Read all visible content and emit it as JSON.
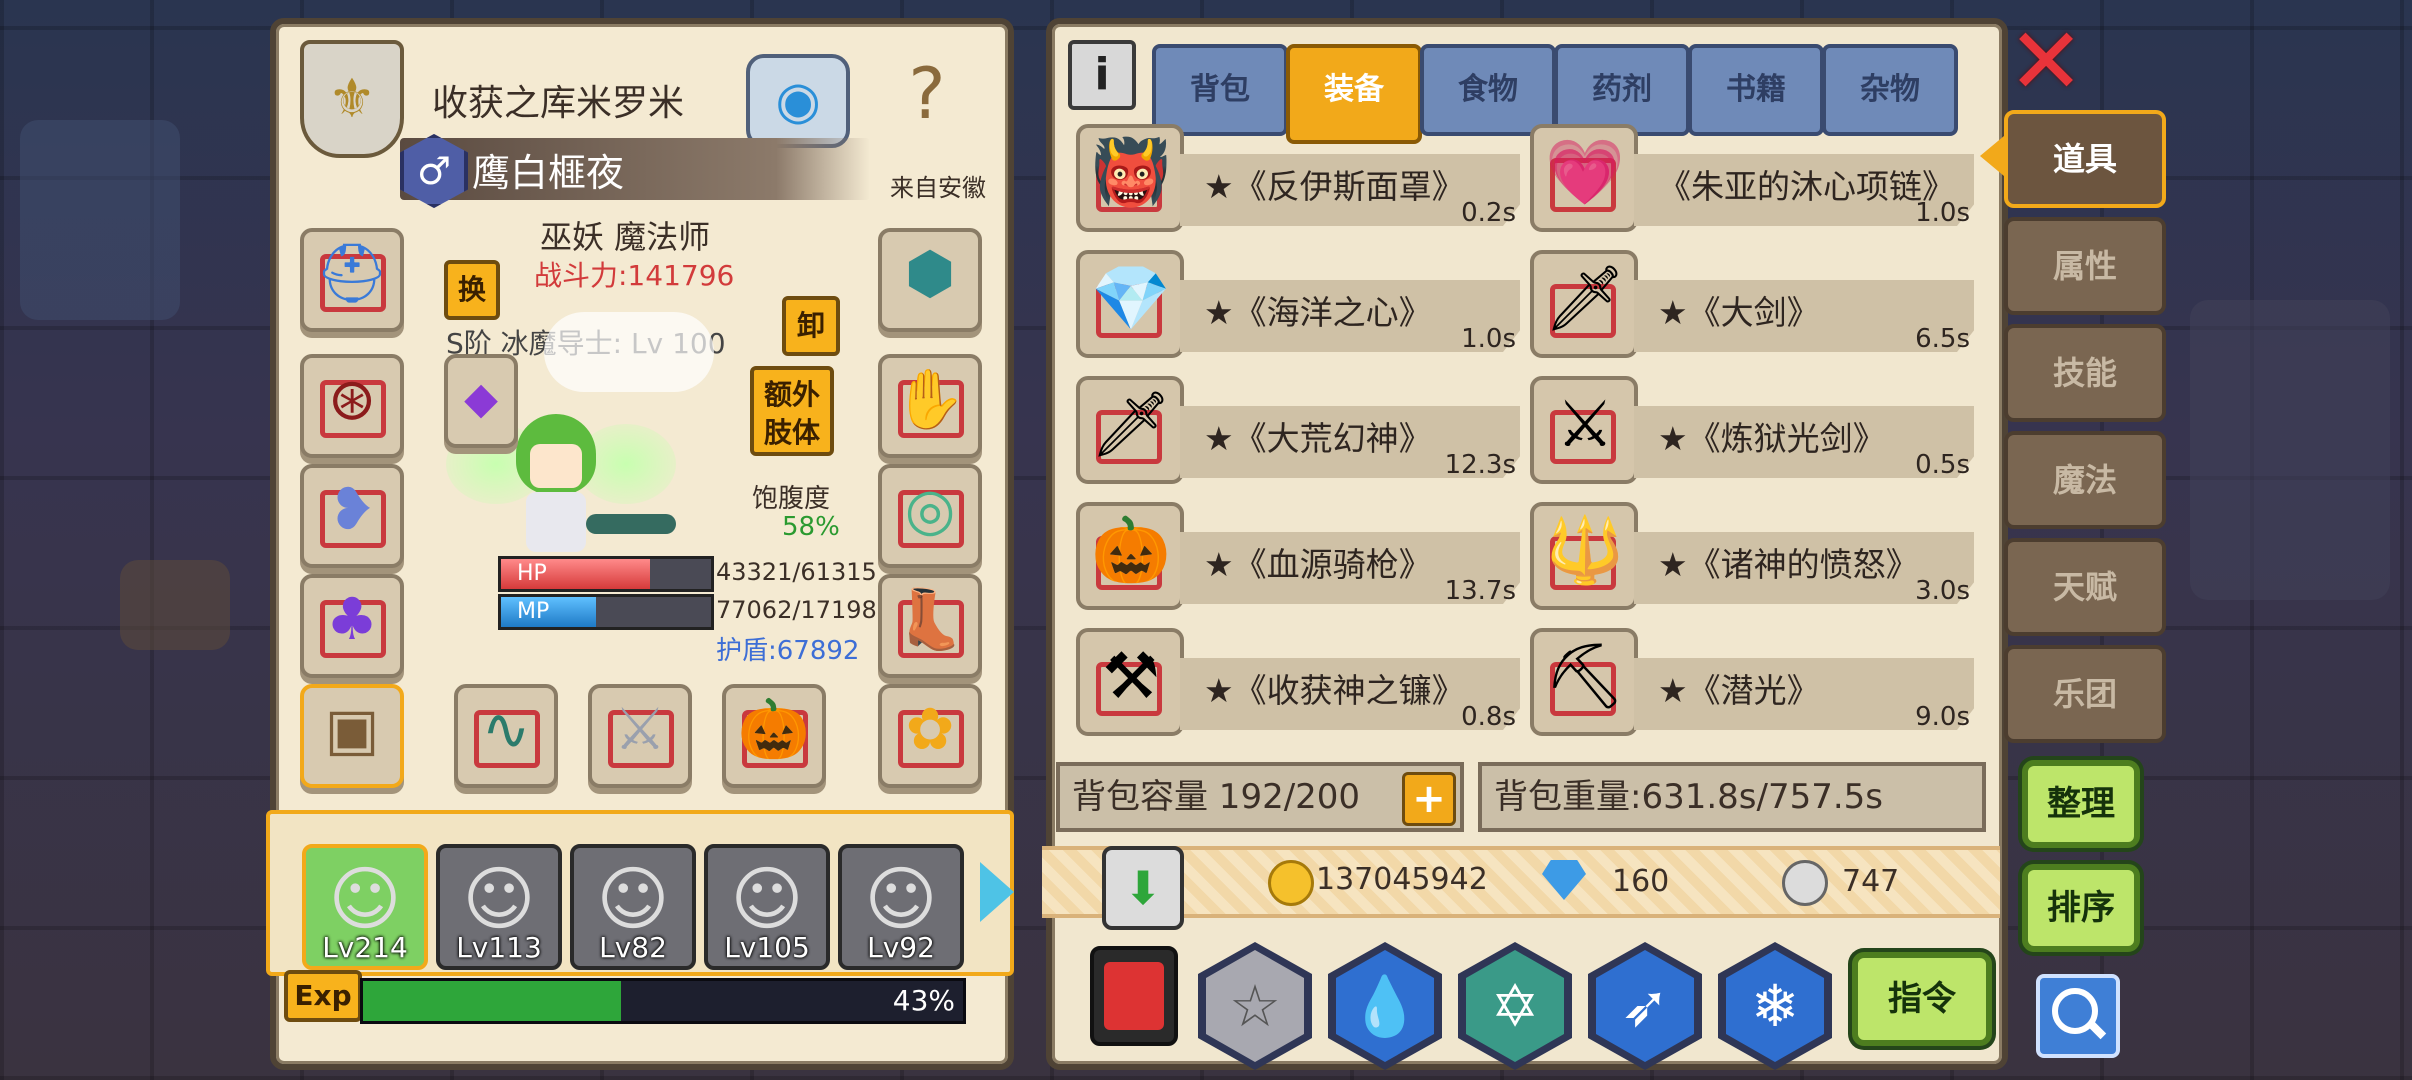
{
  "character": {
    "title": "收获之库米罗米",
    "name": "鹰白榧夜",
    "gender_symbol": "♂",
    "origin": "来自安徽",
    "race_class": "巫妖 魔法师",
    "power": "战斗力:141796",
    "swap_label": "换",
    "unequip_label": "卸",
    "extra_limb_label": "额外\n肢体",
    "rank_line": "S阶 冰魔导士: Lv 100",
    "satiety_label": "饱腹度",
    "satiety_value": "58%",
    "hp_label": "HP",
    "mp_label": "MP",
    "hp_value": "43321/61315",
    "mp_value": "77062/17198",
    "hp_fraction": 0.71,
    "mp_fraction": 0.45,
    "shield": "护盾:67892"
  },
  "party": [
    {
      "level": "Lv214",
      "active": true
    },
    {
      "level": "Lv113",
      "active": false
    },
    {
      "level": "Lv82",
      "active": false
    },
    {
      "level": "Lv105",
      "active": false
    },
    {
      "level": "Lv92",
      "active": false
    }
  ],
  "exp": {
    "label": "Exp",
    "percent_text": "43%",
    "fraction": 0.43
  },
  "tabs": [
    {
      "label": "背包",
      "active": false
    },
    {
      "label": "装备",
      "active": true
    },
    {
      "label": "食物",
      "active": false
    },
    {
      "label": "药剂",
      "active": false
    },
    {
      "label": "书籍",
      "active": false
    },
    {
      "label": "杂物",
      "active": false
    }
  ],
  "items": [
    {
      "name": "★《反伊斯面罩》",
      "time": "0.2s",
      "icon": "demon-mask-icon",
      "glyph": "👹"
    },
    {
      "name": "《朱亚的沐心项链》",
      "time": "1.0s",
      "icon": "heart-necklace-icon",
      "glyph": "💗"
    },
    {
      "name": "★《海洋之心》",
      "time": "1.0s",
      "icon": "sapphire-necklace-icon",
      "glyph": "💎"
    },
    {
      "name": "★《大剑》",
      "time": "6.5s",
      "icon": "greatsword-icon",
      "glyph": "🗡"
    },
    {
      "name": "★《大荒幻神》",
      "time": "12.3s",
      "icon": "dagger-icon",
      "glyph": "🗡"
    },
    {
      "name": "★《炼狱光剑》",
      "time": "0.5s",
      "icon": "lightsaber-icon",
      "glyph": "⚔"
    },
    {
      "name": "★《血源骑枪》",
      "time": "13.7s",
      "icon": "pumpkin-lance-icon",
      "glyph": "🎃"
    },
    {
      "name": "★《诸神的愤怒》",
      "time": "3.0s",
      "icon": "golden-spear-icon",
      "glyph": "🔱"
    },
    {
      "name": "★《收获神之镰》",
      "time": "0.8s",
      "icon": "scythe-icon",
      "glyph": "⚒"
    },
    {
      "name": "★《潜光》",
      "time": "9.0s",
      "icon": "dark-scythe-icon",
      "glyph": "⛏"
    }
  ],
  "bag": {
    "capacity": "背包容量 192/200",
    "weight": "背包重量:631.8s/757.5s"
  },
  "currency": {
    "gold": "137045942",
    "gems": "160",
    "silver": "747"
  },
  "side_tabs": [
    {
      "label": "道具",
      "active": true
    },
    {
      "label": "属性",
      "active": false
    },
    {
      "label": "技能",
      "active": false
    },
    {
      "label": "魔法",
      "active": false
    },
    {
      "label": "天赋",
      "active": false
    },
    {
      "label": "乐团",
      "active": false
    }
  ],
  "buttons": {
    "organize": "整理",
    "sort": "排序",
    "command": "指令"
  },
  "colors": {
    "accent": "#f2a91a",
    "hp": "#e34a4a",
    "mp": "#2f8fd6",
    "exp": "#2ea63a",
    "power": "#d23b3b",
    "shield": "#3d6ed6"
  }
}
